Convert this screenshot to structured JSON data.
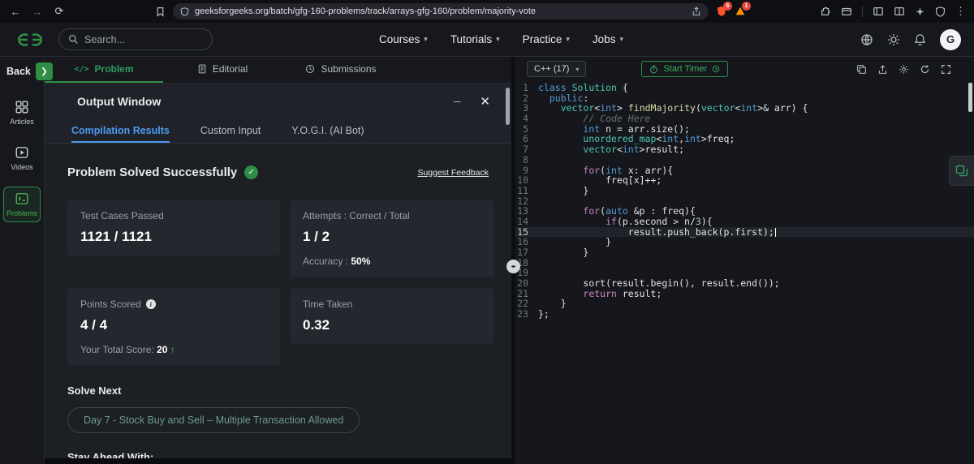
{
  "colors": {
    "accent_green": "#2f8d46",
    "tab_active_blue": "#4e9af0",
    "badge_red": "#e8463c"
  },
  "browser": {
    "url": "geeksforgeeks.org/batch/gfg-160-problems/track/arrays-gfg-160/problem/majority-vote",
    "shield_badge": "6",
    "rewards_badge": "1"
  },
  "header": {
    "search_placeholder": "Search...",
    "nav": [
      {
        "label": "Courses"
      },
      {
        "label": "Tutorials"
      },
      {
        "label": "Practice"
      },
      {
        "label": "Jobs"
      }
    ],
    "avatar_initial": "G"
  },
  "rail": {
    "back": "Back",
    "items": [
      {
        "label": "Articles"
      },
      {
        "label": "Videos"
      },
      {
        "label": "Problems"
      }
    ]
  },
  "panel_tabs": [
    {
      "label": "Problem"
    },
    {
      "label": "Editorial"
    },
    {
      "label": "Submissions"
    }
  ],
  "output": {
    "title": "Output Window",
    "tabs": [
      {
        "label": "Compilation Results"
      },
      {
        "label": "Custom Input"
      },
      {
        "label": "Y.O.G.I. (AI Bot)"
      }
    ],
    "status": "Problem Solved Successfully",
    "feedback_link": "Suggest Feedback",
    "cards": {
      "test_cases": {
        "title": "Test Cases Passed",
        "value": "1121 / 1121"
      },
      "attempts": {
        "title": "Attempts : Correct / Total",
        "value": "1 / 2",
        "sub_label": "Accuracy :",
        "sub_value": "50%"
      },
      "points": {
        "title": "Points Scored",
        "value": "4 / 4",
        "sub_label": "Your Total Score:",
        "sub_value": "20",
        "sub_trend": "↑"
      },
      "time": {
        "title": "Time Taken",
        "value": "0.32"
      }
    },
    "solve_next_heading": "Solve Next",
    "solve_next_button": "Day 7 - Stock Buy and Sell – Multiple Transaction Allowed",
    "footer_heading": "Stay Ahead With:"
  },
  "editor": {
    "language": "C++ (17)",
    "start_timer": "Start Timer",
    "active_line": 15,
    "lines": [
      [
        [
          "class",
          "kw"
        ],
        [
          " "
        ],
        [
          "Solution",
          "type"
        ],
        [
          " {"
        ]
      ],
      [
        [
          "  "
        ],
        [
          "public",
          "kw"
        ],
        [
          ":"
        ]
      ],
      [
        [
          "    "
        ],
        [
          "vector",
          "type"
        ],
        [
          "<"
        ],
        [
          "int",
          "kw"
        ],
        [
          ">"
        ],
        [
          " "
        ],
        [
          "findMajority",
          "fn"
        ],
        [
          "("
        ],
        [
          "vector",
          "type"
        ],
        [
          "<"
        ],
        [
          "int",
          "kw"
        ],
        [
          ">& arr) {"
        ]
      ],
      [
        [
          "        "
        ],
        [
          "// Code Here",
          "cm"
        ]
      ],
      [
        [
          "        "
        ],
        [
          "int",
          "kw"
        ],
        [
          " n = arr.size();"
        ]
      ],
      [
        [
          "        "
        ],
        [
          "unordered_map",
          "type"
        ],
        [
          "<"
        ],
        [
          "int",
          "kw"
        ],
        [
          ","
        ],
        [
          "int",
          "kw"
        ],
        [
          ">freq;"
        ]
      ],
      [
        [
          "        "
        ],
        [
          "vector",
          "type"
        ],
        [
          "<"
        ],
        [
          "int",
          "kw"
        ],
        [
          ">result;"
        ]
      ],
      [],
      [
        [
          "        "
        ],
        [
          "for",
          "ctrl"
        ],
        [
          "("
        ],
        [
          "int",
          "kw"
        ],
        [
          " x: arr){"
        ]
      ],
      [
        [
          "            freq[x]++;"
        ]
      ],
      [
        [
          "        }"
        ]
      ],
      [],
      [
        [
          "        "
        ],
        [
          "for",
          "ctrl"
        ],
        [
          "("
        ],
        [
          "auto",
          "kw"
        ],
        [
          " &p : freq){"
        ]
      ],
      [
        [
          "            "
        ],
        [
          "if",
          "ctrl"
        ],
        [
          "(p.second > n/"
        ],
        [
          "3",
          "num"
        ],
        [
          "){"
        ]
      ],
      [
        [
          "                result.push_back(p.first);"
        ]
      ],
      [
        [
          "            }"
        ]
      ],
      [
        [
          "        }"
        ]
      ],
      [],
      [],
      [
        [
          "        sort(result.begin(), result.end());"
        ]
      ],
      [
        [
          "        "
        ],
        [
          "return",
          "ctrl"
        ],
        [
          " result;"
        ]
      ],
      [
        [
          "    }"
        ]
      ],
      [
        [
          "};"
        ]
      ]
    ]
  },
  "icons": {
    "minimize": "─",
    "close": "✕",
    "chevron": "▾",
    "splitter": "◂▸",
    "back": "←",
    "forward": "→",
    "reload": "⟳",
    "menu": "⋮",
    "back_chev": "❯",
    "check": "✓",
    "info": "i"
  }
}
